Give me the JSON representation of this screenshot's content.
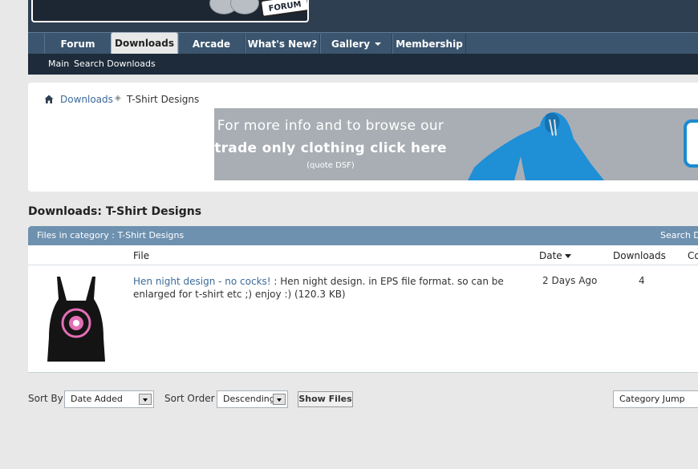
{
  "header": {
    "logo_tag": "FORUM"
  },
  "nav": {
    "tabs": [
      {
        "label": "Forum",
        "active": false
      },
      {
        "label": "Downloads",
        "active": true
      },
      {
        "label": "Arcade",
        "active": false
      },
      {
        "label": "What's New?",
        "active": false
      },
      {
        "label": "Gallery",
        "active": false,
        "dropdown": true
      },
      {
        "label": "Membership",
        "active": false
      }
    ],
    "subnav": [
      "Main",
      "Search Downloads"
    ]
  },
  "breadcrumb": {
    "icon": "home-icon",
    "link": "Downloads",
    "current": "T-Shirt Designs"
  },
  "banner": {
    "line1": "For more info and to browse our",
    "line2": "trade only clothing click here",
    "note": "(quote DSF)",
    "colors": {
      "background": "#a9aeb4",
      "hoodie": "#1f8fd6"
    }
  },
  "section": {
    "title": "Downloads: T-Shirt Designs"
  },
  "table": {
    "caption": "Files in category : T-Shirt Designs",
    "search_link": "Search Dc",
    "columns": {
      "file": "File",
      "date": "Date",
      "downloads": "Downloads",
      "comments": "Co"
    },
    "rows": [
      {
        "title": "Hen night design - no cocks!",
        "description": " : Hen night design. in EPS file format. so can be enlarged for t-shirt etc ;) enjoy :) (120.3 KB)",
        "date": "2 Days Ago",
        "downloads": "4"
      }
    ]
  },
  "controls": {
    "sort_by_label": "Sort By",
    "sort_by_value": "Date Added",
    "sort_order_label": "Sort Order",
    "sort_order_value": "Descending",
    "show_button": "Show Files",
    "category_jump": "Category Jump"
  },
  "colors": {
    "header": "#2f3f52",
    "nav": "#3b556e",
    "subnav": "#1d2b3a",
    "table_head": "#6e91b0",
    "link": "#3a6a9a"
  }
}
